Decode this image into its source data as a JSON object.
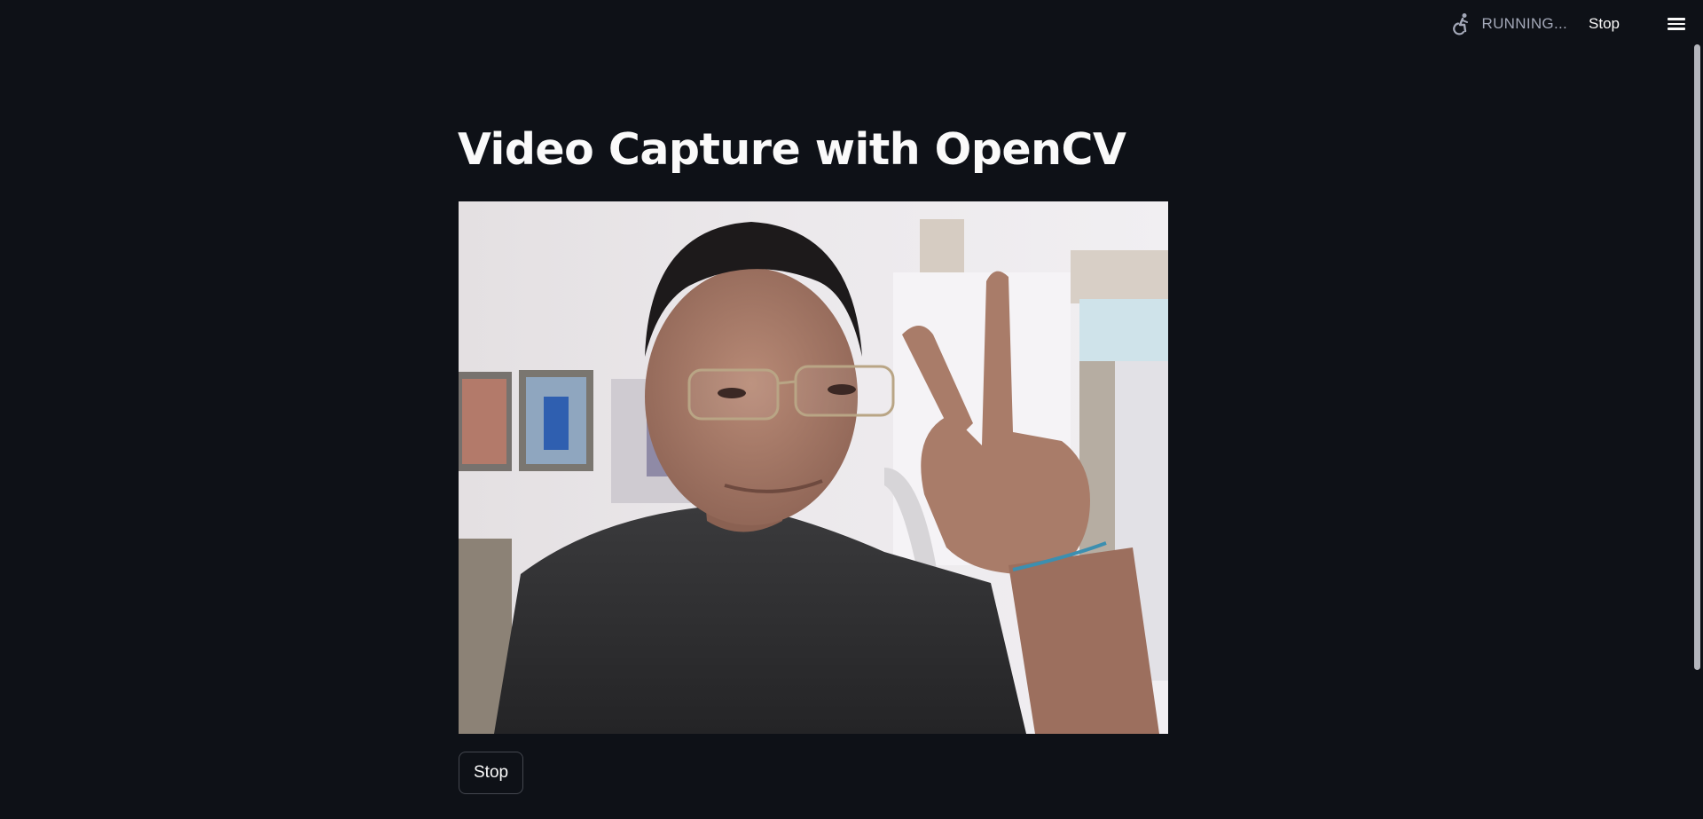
{
  "header": {
    "status_text": "RUNNING...",
    "stop_label": "Stop",
    "status_icon": "running-person-icon",
    "menu_icon": "hamburger-menu-icon"
  },
  "main": {
    "title": "Video Capture with OpenCV",
    "video_feed": "webcam-frame",
    "stop_button_label": "Stop"
  },
  "colors": {
    "background": "#0e1117",
    "text": "#fafafa",
    "muted_text": "#a3a8b8",
    "button_border": "#44474f"
  }
}
